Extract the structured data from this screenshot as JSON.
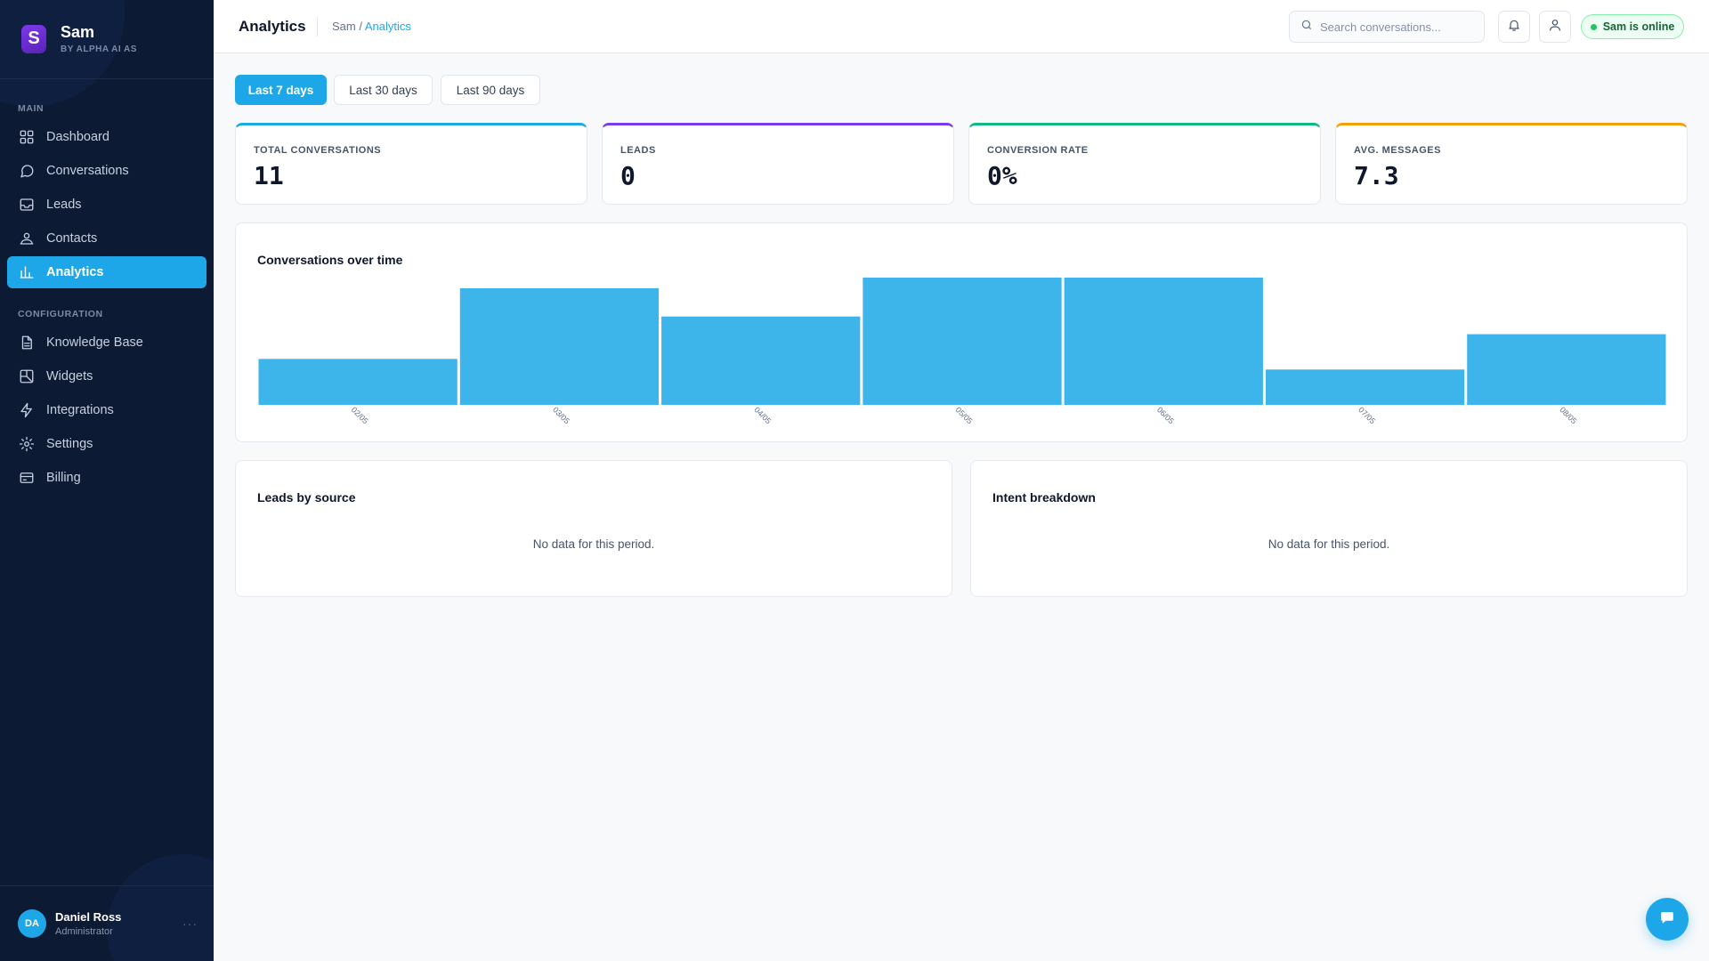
{
  "brand": {
    "name": "Sam",
    "tagline": "BY ALPHA AI AS",
    "logo_letter": "S"
  },
  "sidebar": {
    "main_label": "MAIN",
    "main_items": [
      {
        "label": "Dashboard",
        "icon": "dashboard-icon"
      },
      {
        "label": "Conversations",
        "icon": "chat-bubble-icon"
      },
      {
        "label": "Leads",
        "icon": "inbox-icon"
      },
      {
        "label": "Contacts",
        "icon": "contacts-icon"
      },
      {
        "label": "Analytics",
        "icon": "bar-chart-icon",
        "active": true
      }
    ],
    "config_label": "CONFIGURATION",
    "config_items": [
      {
        "label": "Knowledge Base",
        "icon": "document-icon"
      },
      {
        "label": "Widgets",
        "icon": "widget-icon"
      },
      {
        "label": "Integrations",
        "icon": "lightning-icon"
      },
      {
        "label": "Settings",
        "icon": "gear-icon"
      },
      {
        "label": "Billing",
        "icon": "credit-card-icon"
      }
    ],
    "user": {
      "initials": "DA",
      "name": "Daniel Ross",
      "role": "Administrator",
      "menu": "···"
    }
  },
  "header": {
    "title": "Analytics",
    "breadcrumb_root": "Sam",
    "breadcrumb_sep": " / ",
    "breadcrumb_current": "Analytics",
    "search_placeholder": "Search conversations...",
    "status": "Sam is online"
  },
  "range_tabs": [
    {
      "label": "Last 7 days",
      "active": true
    },
    {
      "label": "Last 30 days",
      "active": false
    },
    {
      "label": "Last 90 days",
      "active": false
    }
  ],
  "stats": [
    {
      "label": "TOTAL CONVERSATIONS",
      "value": "11",
      "color": "#1ea7e8"
    },
    {
      "label": "LEADS",
      "value": "0",
      "color": "#7c3aed"
    },
    {
      "label": "CONVERSION RATE",
      "value": "0%",
      "color": "#10b981"
    },
    {
      "label": "AVG. MESSAGES",
      "value": "7.3",
      "color": "#f59e0b"
    }
  ],
  "chart_card": {
    "title": "Conversations over time"
  },
  "chart_data": {
    "type": "bar",
    "title": "Conversations over time",
    "categories": [
      "02/05",
      "03/05",
      "04/05",
      "05/05",
      "06/05",
      "07/05",
      "08/05"
    ],
    "values": [
      1.3,
      3.3,
      2.5,
      3.6,
      3.6,
      1.0,
      2.0
    ],
    "ylim": [
      0,
      3.6
    ],
    "grid": false,
    "color": "#3db5ea"
  },
  "leads_card": {
    "title": "Leads by source",
    "empty": "No data for this period."
  },
  "intent_card": {
    "title": "Intent breakdown",
    "empty": "No data for this period."
  },
  "fab": {
    "icon": "chat-icon"
  }
}
